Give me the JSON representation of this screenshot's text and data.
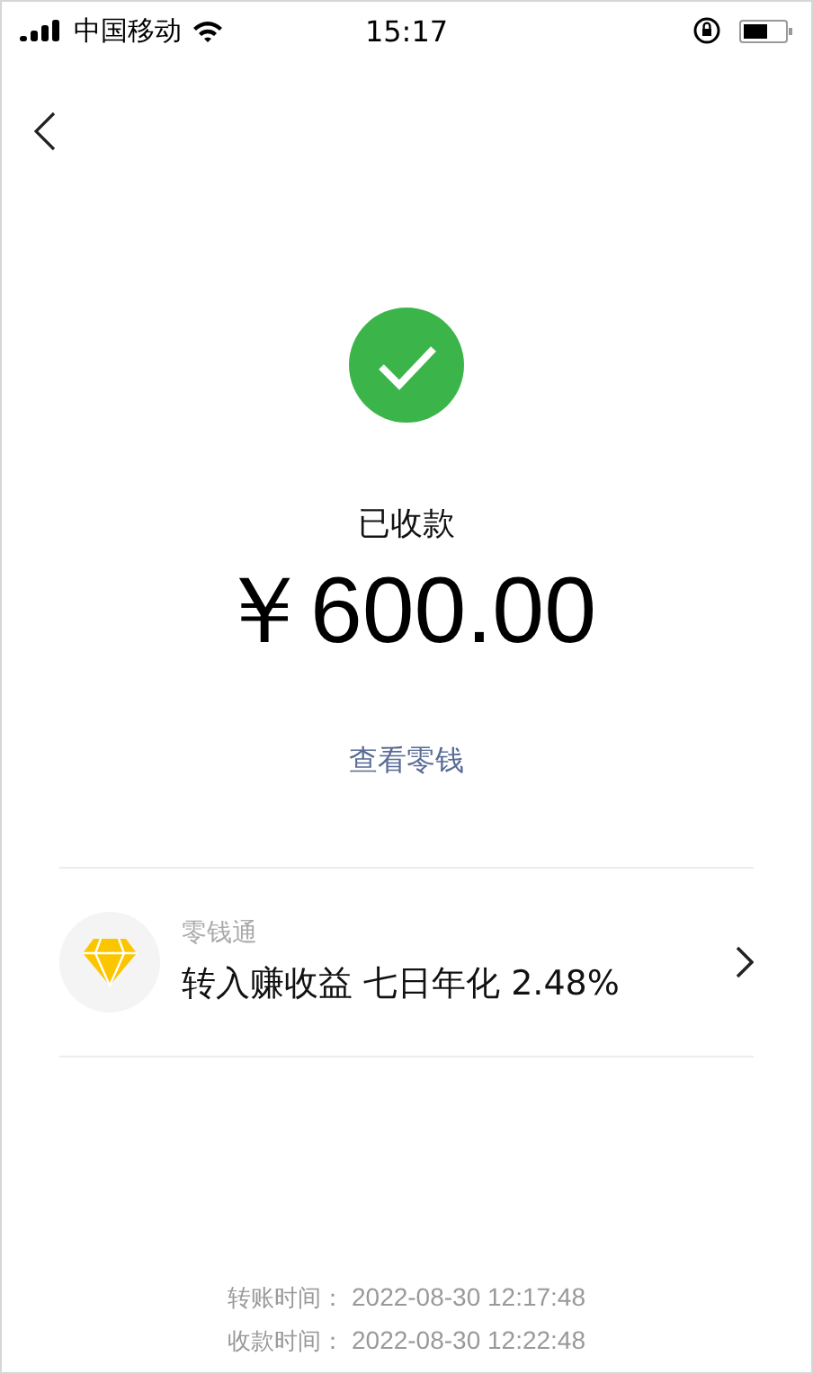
{
  "status_bar": {
    "carrier": "中国移动",
    "time": "15:17"
  },
  "result": {
    "status": "已收款",
    "amount": "￥600.00",
    "link": "查看零钱"
  },
  "promo": {
    "title": "零钱通",
    "text": "转入赚收益 七日年化 2.48%"
  },
  "details": [
    {
      "label": "转账时间：",
      "value": "2022-08-30 12:17:48"
    },
    {
      "label": "收款时间：",
      "value": "2022-08-30 12:22:48"
    }
  ]
}
